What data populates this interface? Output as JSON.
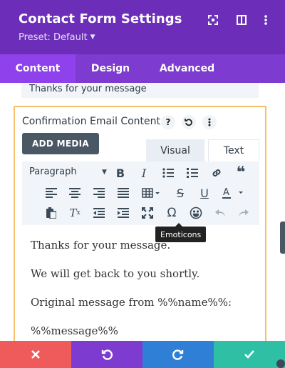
{
  "header": {
    "title": "Contact Form Settings",
    "preset": "Preset: Default",
    "icons": [
      "fullscreen-icon",
      "sidebar-toggle-icon",
      "more-vertical-icon"
    ]
  },
  "tabs": [
    {
      "label": "Content",
      "active": true
    },
    {
      "label": "Design",
      "active": false
    },
    {
      "label": "Advanced",
      "active": false
    }
  ],
  "previous_field": {
    "value": "Thanks for your message"
  },
  "email_content": {
    "label": "Confirmation Email Content",
    "label_icons": [
      "help-icon",
      "reset-icon",
      "more-vertical-icon"
    ],
    "add_media_label": "ADD MEDIA",
    "editor_tabs": [
      {
        "label": "Visual",
        "active": true
      },
      {
        "label": "Text",
        "active": false
      }
    ],
    "format_select": "Paragraph",
    "toolbar_icons": [
      "bold-icon",
      "italic-icon",
      "bulleted-list-icon",
      "numbered-list-icon",
      "link-icon",
      "blockquote-icon",
      "align-left-icon",
      "align-center-icon",
      "align-right-icon",
      "align-justify-icon",
      "table-icon",
      "strikethrough-icon",
      "underline-icon",
      "text-color-icon",
      "paste-icon",
      "clear-formatting-icon",
      "outdent-icon",
      "indent-icon",
      "fullscreen-icon",
      "special-character-icon",
      "emoticons-icon",
      "undo-icon",
      "redo-icon"
    ],
    "tooltip": "Emoticons",
    "paragraphs": [
      "Thanks for your message.",
      "We will get back to you shortly.",
      "Original message from %%name%%:",
      "%%message%%"
    ]
  },
  "bottom_bar": [
    {
      "action": "cancel",
      "icon": "close-icon",
      "color": "#ef5b5b"
    },
    {
      "action": "undo",
      "icon": "undo-icon",
      "color": "#7d3bcf"
    },
    {
      "action": "redo",
      "icon": "redo-icon",
      "color": "#2f7fd6"
    },
    {
      "action": "save",
      "icon": "check-icon",
      "color": "#2ebfa5"
    }
  ],
  "colors": {
    "header": "#6c2eb9",
    "tab_bar": "#7d3bcf",
    "active_tab": "#8f42ec",
    "panel_border": "#f5c26b"
  }
}
